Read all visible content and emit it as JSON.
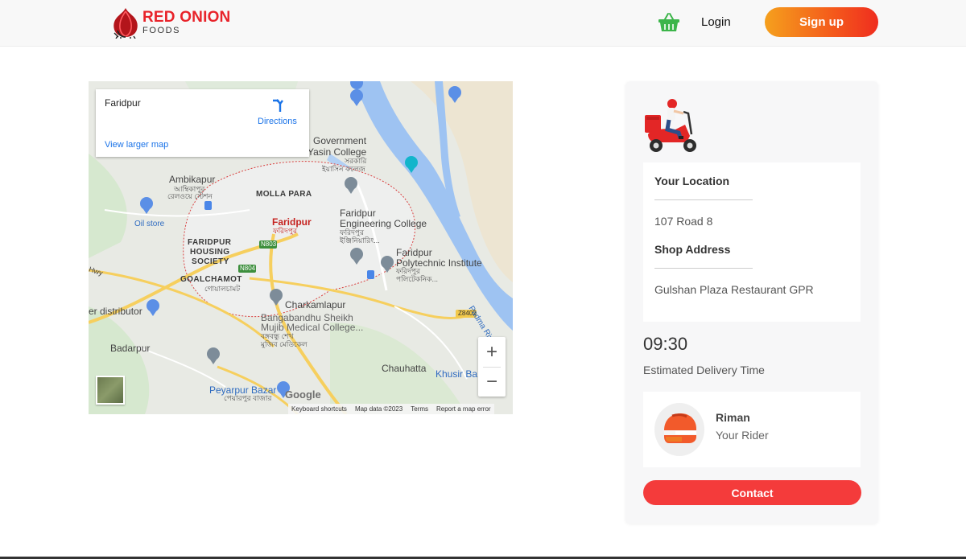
{
  "brand": {
    "name_red": "RED ONION",
    "subtitle": "FOODS",
    "colors": {
      "primary": "#e8232a",
      "accent_start": "#f5a01d",
      "accent_end": "#ef2d1f"
    }
  },
  "header": {
    "cart_icon": "shopping-basket-icon",
    "login_label": "Login",
    "signup_label": "Sign up"
  },
  "map": {
    "place_name": "Faridpur",
    "directions_label": "Directions",
    "view_larger_label": "View larger map",
    "zoom_in_label": "+",
    "zoom_out_label": "−",
    "google_label": "Google",
    "footer": [
      "Keyboard shortcuts",
      "Map data ©2023",
      "Terms",
      "Report a map error"
    ],
    "labels": {
      "government": "Government",
      "yasin_college": "Yasin College",
      "yasin_bn1": "সরকারি",
      "yasin_bn2": "ইয়াসিন কলেজ",
      "ambikapur": "Ambikapur",
      "ambikapur_bn1": "আম্বিকাপুর",
      "ambikapur_bn2": "রেলওয়ে স্টেশন",
      "molla_para": "MOLLA PARA",
      "faridpur": "Faridpur",
      "faridpur_bn": "ফরিদপুর",
      "oil_store": "Oil store",
      "faridpur_housing1": "FARIDPUR",
      "faridpur_housing2": "HOUSING",
      "faridpur_housing3": "SOCIETY",
      "n803": "N803",
      "n804": "N804",
      "eng_college1": "Faridpur",
      "eng_college2": "Engineering College",
      "eng_college_bn1": "ফরিদপুর",
      "eng_college_bn2": "ইঞ্জিনিয়ারিং...",
      "poly1": "Faridpur",
      "poly2": "Polytechnic Institute",
      "poly_bn1": "ফরিদপুর",
      "poly_bn2": "পলিটেকনিক...",
      "goalchamot": "GOALCHAMOT",
      "goalchamot_bn": "গোয়ালচামট",
      "hwy": "Hwy",
      "distributor": "er distributor",
      "charkamlapur": "Charkamlapur",
      "bsmmc1": "Bangabandhu Sheikh",
      "bsmmc2": "Mujib Medical College...",
      "bsmmc_bn1": "বঙ্গবন্ধু শেখ",
      "bsmmc_bn2": "মুজিব মেডিকেল",
      "z8402": "Z8402",
      "padma_river": "Padma River",
      "badarpur": "Badarpur",
      "chauhatta": "Chauhatta",
      "khusir_ba": "Khusir Ba",
      "peyarpur_bazar": "Peyarpur Bazar",
      "peyarpur_bn": "পেয়ারপুর বাজার"
    }
  },
  "panel": {
    "your_location_heading": "Your Location",
    "your_location_value": "107 Road 8",
    "shop_address_heading": "Shop Address",
    "shop_address_value": "Gulshan Plaza Restaurant GPR",
    "delivery_time": "09:30",
    "delivery_time_label": "Estimated Delivery Time",
    "rider_name": "Riman",
    "rider_role": "Your Rider",
    "contact_label": "Contact"
  }
}
